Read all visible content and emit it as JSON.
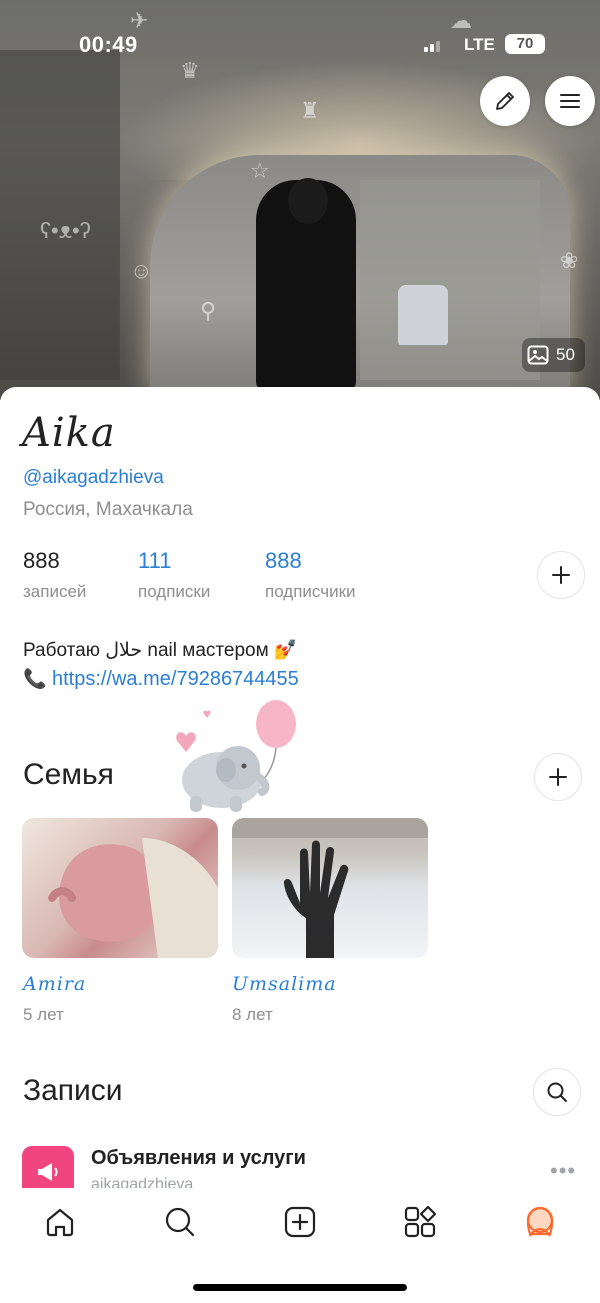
{
  "status_bar": {
    "time": "00:49",
    "network": "LTE",
    "battery": "70"
  },
  "cover": {
    "photo_count": "50"
  },
  "profile": {
    "name": "Aika",
    "handle": "@aikagadzhieva",
    "location": "Россия, Махачкала",
    "stats": [
      {
        "value": "888",
        "label": "записей"
      },
      {
        "value": "111",
        "label": "подписки"
      },
      {
        "value": "888",
        "label": "подписчики"
      }
    ],
    "bio_line1": "Работаю حلال nail мастером 💅",
    "bio_phone_emoji": "📞",
    "bio_link": "https://wa.me/79286744455"
  },
  "family": {
    "title": "Семья",
    "members": [
      {
        "name": "Amira",
        "age": "5 лет"
      },
      {
        "name": "Umsalima",
        "age": "8 лет"
      }
    ]
  },
  "posts": {
    "title": "Записи",
    "first": {
      "title": "Объявления и услуги",
      "subtitle": "aikagadzhieva"
    }
  },
  "colors": {
    "accent": "#2a7fd4",
    "post_icon": "#f0457e",
    "profile_tab": "#ff6a2c"
  },
  "icons": [
    "pencil-icon",
    "menu-icon",
    "image-icon",
    "plus-icon",
    "search-icon",
    "home-icon",
    "add-square-icon",
    "services-icon",
    "profile-icon",
    "megaphone-icon",
    "more-icon"
  ]
}
